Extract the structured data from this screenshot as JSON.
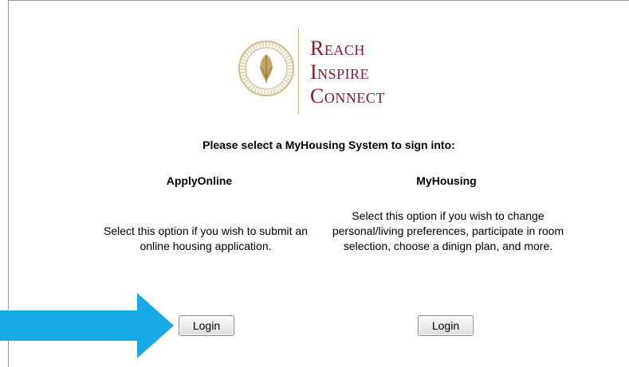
{
  "logo": {
    "tagline": [
      "Reach",
      "Inspire",
      "Connect"
    ]
  },
  "heading": "Please select a MyHousing System to sign into:",
  "options": [
    {
      "title": "ApplyOnline",
      "description": "Select this option if you wish to submit an online housing application.",
      "button_label": "Login"
    },
    {
      "title": "MyHousing",
      "description": "Select this option if you wish to change personal/living preferences, participate in room selection, choose a dinign plan, and more.",
      "button_label": "Login"
    }
  ],
  "colors": {
    "brand": "#7a1f2b",
    "arrow": "#16a9e6",
    "seal": "#b8a06a"
  },
  "icons": {
    "seal": "college-seal-icon",
    "arrow": "arrow-right-icon"
  }
}
